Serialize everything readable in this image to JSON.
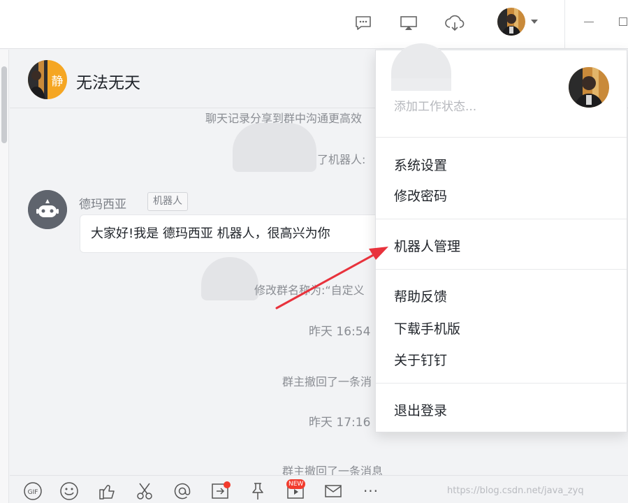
{
  "colors": {
    "accent_orange": "#f5a623",
    "annotation_arrow": "#e8323c",
    "badge_red": "#f23b2d",
    "bot_avatar_bg": "#5f646d"
  },
  "topbar": {
    "icons": [
      "message-icon",
      "screen-share-icon",
      "cloud-upload-icon"
    ]
  },
  "chat": {
    "group_avatar_char": "静",
    "group_title": "无法无天",
    "system_messages": [
      "聊天记录分享到群中沟通更高效",
      "了机器人:",
      "修改群名称为:“自定义",
      "群主撤回了一条消",
      "群主撤回了一条消息"
    ],
    "timestamps": [
      "昨天 16:54",
      "昨天 17:16"
    ],
    "sender_name": "德玛西亚",
    "sender_tag": "机器人",
    "bubble_text": "大家好!我是 德玛西亚 机器人，很高兴为你"
  },
  "toolbar": {
    "gif_label": "GIF",
    "new_badge": "NEW",
    "more_label": "···"
  },
  "watermark": "https://blog.csdn.net/java_zyq",
  "menu": {
    "status_placeholder": "添加工作状态...",
    "items": {
      "settings": "系统设置",
      "change_password": "修改密码",
      "robot_management": "机器人管理",
      "feedback": "帮助反馈",
      "download_mobile": "下载手机版",
      "about": "关于钉钉",
      "logout": "退出登录"
    }
  }
}
